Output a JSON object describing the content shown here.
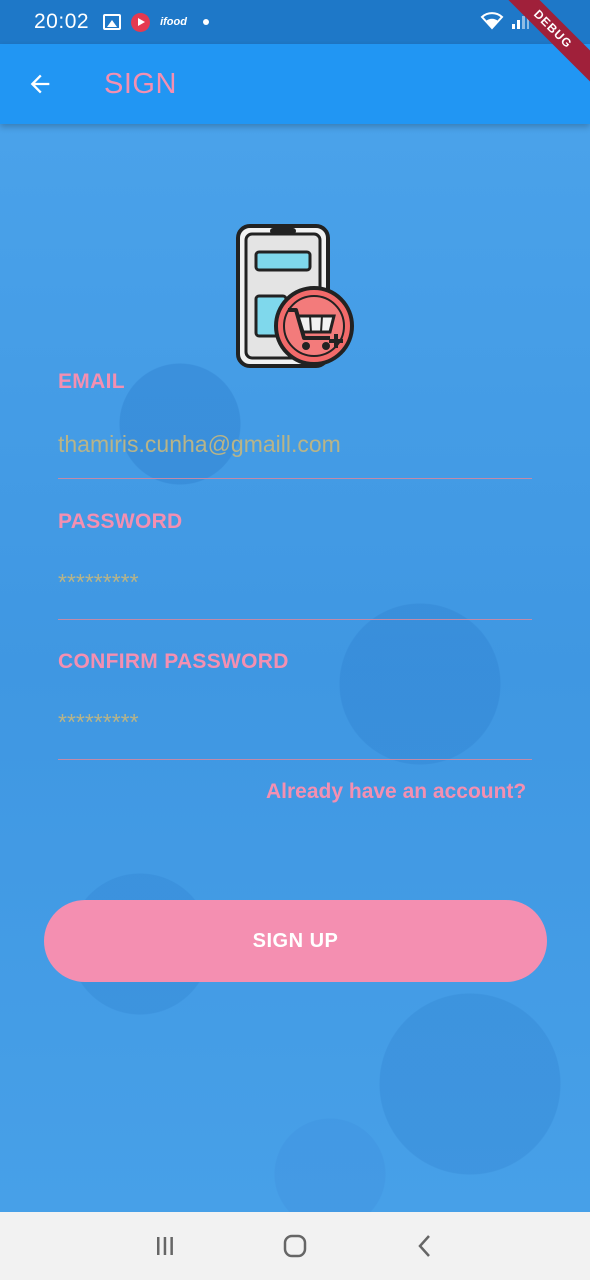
{
  "status_bar": {
    "time": "20:02",
    "icons_left": [
      "gallery-icon",
      "youtube-icon",
      "ifood-icon",
      "dot-icon"
    ],
    "ifood_text": "ifood",
    "icons_right": [
      "wifi-icon",
      "signal-icon"
    ]
  },
  "debug_banner": "DEBUG",
  "app_bar": {
    "back_icon": "arrow-left-icon",
    "title": "SIGN"
  },
  "logo": {
    "icon": "phone-cart-icon"
  },
  "form": {
    "email": {
      "label": "EMAIL",
      "placeholder": "thamiris.cunha@gmaill.com"
    },
    "password": {
      "label": "PASSWORD",
      "placeholder": "*********"
    },
    "confirm_password": {
      "label": "CONFIRM PASSWORD",
      "placeholder": "*********"
    },
    "login_link": "Already have an account?",
    "submit_label": "SIGN UP"
  },
  "nav_bar": {
    "buttons": [
      "recent-apps-icon",
      "home-icon",
      "back-icon"
    ]
  },
  "colors": {
    "status_bar": "#1e78c8",
    "app_bar": "#2196f3",
    "background": "#4aa0e8",
    "accent_pink": "#f48fb1",
    "input_text": "#b8b488",
    "nav_bar": "#f2f2f2"
  }
}
